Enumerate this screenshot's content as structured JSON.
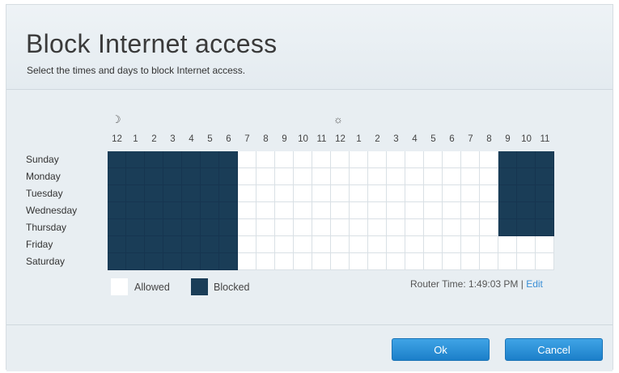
{
  "header": {
    "title": "Block Internet access",
    "subtitle": "Select the times and days to block Internet access."
  },
  "schedule": {
    "icons": {
      "night": "moon-icon",
      "day": "sun-icon"
    },
    "hours": [
      "12",
      "1",
      "2",
      "3",
      "4",
      "5",
      "6",
      "7",
      "8",
      "9",
      "10",
      "11",
      "12",
      "1",
      "2",
      "3",
      "4",
      "5",
      "6",
      "7",
      "8",
      "9",
      "10",
      "11"
    ],
    "days": [
      "Sunday",
      "Monday",
      "Tuesday",
      "Wednesday",
      "Thursday",
      "Friday",
      "Saturday"
    ],
    "blocked": {
      "Sunday": [
        0,
        1,
        2,
        3,
        4,
        5,
        6,
        21,
        22,
        23
      ],
      "Monday": [
        0,
        1,
        2,
        3,
        4,
        5,
        6,
        21,
        22,
        23
      ],
      "Tuesday": [
        0,
        1,
        2,
        3,
        4,
        5,
        6,
        21,
        22,
        23
      ],
      "Wednesday": [
        0,
        1,
        2,
        3,
        4,
        5,
        6,
        21,
        22,
        23
      ],
      "Thursday": [
        0,
        1,
        2,
        3,
        4,
        5,
        6,
        21,
        22,
        23
      ],
      "Friday": [
        0,
        1,
        2,
        3,
        4,
        5,
        6
      ],
      "Saturday": [
        0,
        1,
        2,
        3,
        4,
        5,
        6
      ]
    },
    "colors": {
      "blocked": "#1a3d57",
      "allowed": "#ffffff"
    }
  },
  "legend": {
    "allowed_label": "Allowed",
    "blocked_label": "Blocked"
  },
  "router_time": {
    "label": "Router Time: 1:49:03 PM | ",
    "edit_label": "Edit"
  },
  "footer": {
    "ok_label": "Ok",
    "cancel_label": "Cancel"
  }
}
